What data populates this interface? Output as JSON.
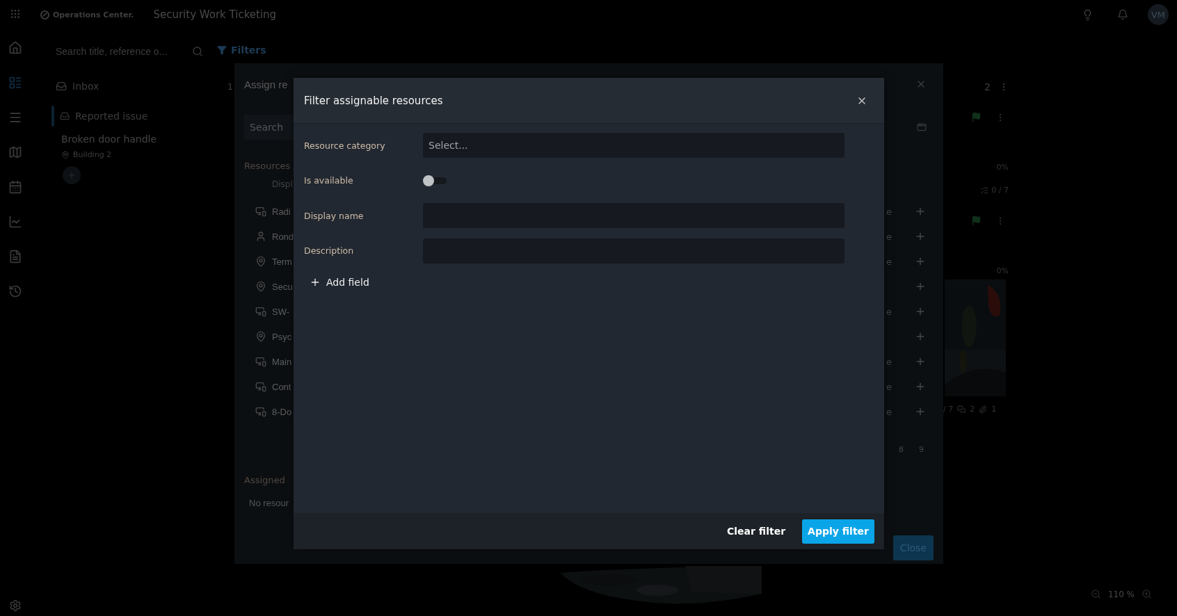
{
  "app": {
    "logo": "Operations Center.",
    "title": "Security Work Ticketing",
    "avatar": "VM"
  },
  "search": {
    "placeholder": "Search title, reference o..."
  },
  "filters_button": "Filters",
  "inbox": {
    "label": "Inbox",
    "count": "1"
  },
  "ticket": {
    "category": "Reported issue",
    "title": "Broken door handle",
    "location": "Building 2"
  },
  "board": {
    "count": "2",
    "cards": [
      {
        "progress": "0%",
        "checklist": "0 / 7"
      },
      {
        "progress": "0%"
      }
    ],
    "footer": {
      "checklist": "/ 7",
      "comments": "2",
      "attachments": "1"
    }
  },
  "zoom": {
    "level": "110 %"
  },
  "assign_dialog": {
    "title": "Assign re",
    "search_placeholder": "Search",
    "resources_label": "Resources",
    "column_1": "Displ",
    "rows": [
      {
        "kind": "device",
        "name": "Radi",
        "column_3": "e"
      },
      {
        "kind": "person",
        "name": "Rond",
        "column_3": "e"
      },
      {
        "kind": "location",
        "name": "Term",
        "column_3": "e"
      },
      {
        "kind": "location",
        "name": "Secu"
      },
      {
        "kind": "device",
        "name": "SW-",
        "column_3": "e"
      },
      {
        "kind": "location",
        "name": "Psyc"
      },
      {
        "kind": "device",
        "name": "Main",
        "column_3": "e"
      },
      {
        "kind": "device",
        "name": "Cont",
        "column_3": "e"
      },
      {
        "kind": "device",
        "name": "8-Do",
        "column_3": "e"
      }
    ],
    "pages": [
      "8",
      "9"
    ],
    "assigned_label": "Assigned",
    "empty_text": "No resour",
    "close_button": "Close"
  },
  "filter_dialog": {
    "title": "Filter assignable resources",
    "fields": [
      {
        "kind": "select",
        "label": "Resource category",
        "placeholder": "Select..."
      },
      {
        "kind": "toggle",
        "label": "Is available",
        "on": false
      },
      {
        "kind": "text",
        "label": "Display name"
      },
      {
        "kind": "text",
        "label": "Description"
      }
    ],
    "add_field": "Add field",
    "clear_button": "Clear filter",
    "apply_button": "Apply filter"
  }
}
